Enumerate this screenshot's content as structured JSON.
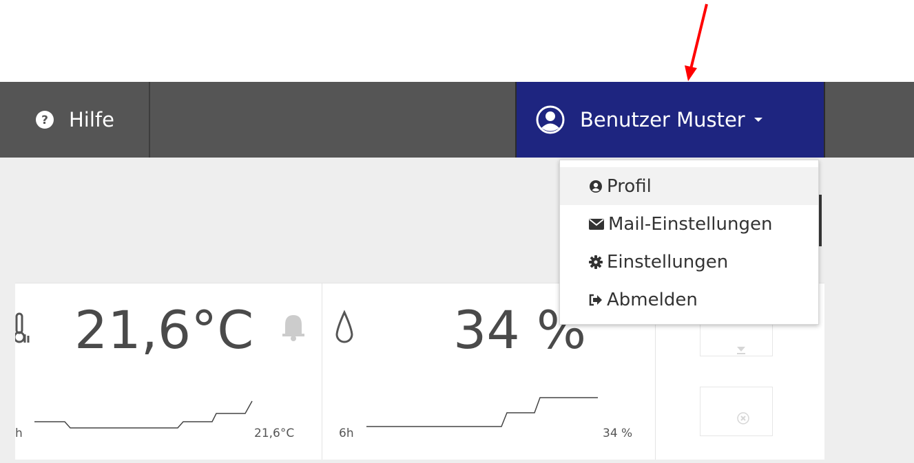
{
  "nav": {
    "help_label": "Hilfe",
    "user_label": "Benutzer Muster"
  },
  "dropdown": {
    "items": [
      {
        "label": "Profil",
        "icon": "user-circle-icon"
      },
      {
        "label": "Mail-Einstellungen",
        "icon": "envelope-icon"
      },
      {
        "label": "Einstellungen",
        "icon": "gear-icon"
      },
      {
        "label": "Abmelden",
        "icon": "sign-out-icon"
      }
    ]
  },
  "sensors": {
    "temperature": {
      "value": "21,6°C",
      "range_label": "h",
      "current_label": "21,6°C"
    },
    "humidity": {
      "value": "34 %",
      "range_label": "6h",
      "current_label": "34 %"
    }
  },
  "colors": {
    "navbar": "#555555",
    "user_menu": "#1e2580",
    "annotation_arrow": "#ff0000"
  }
}
